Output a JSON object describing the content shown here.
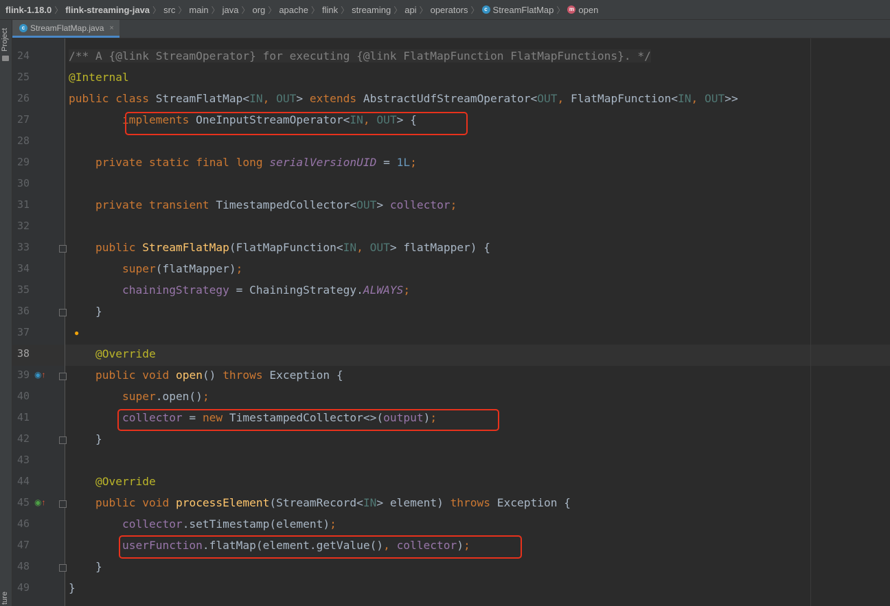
{
  "breadcrumb": {
    "items": [
      "flink-1.18.0",
      "flink-streaming-java",
      "src",
      "main",
      "java",
      "org",
      "apache",
      "flink",
      "streaming",
      "api",
      "operators",
      "StreamFlatMap",
      "open"
    ],
    "class_badge": "c",
    "method_badge": "m"
  },
  "sidebar": {
    "project_label": "Project",
    "structure_label": "ture"
  },
  "tabs": [
    {
      "label": "StreamFlatMap.java",
      "close": "×"
    }
  ],
  "editor": {
    "current_line": "38",
    "lines": [
      {
        "num": "24",
        "text": "/** A {@link StreamOperator} for executing {@link FlatMapFunction FlatMapFunctions}. */"
      },
      {
        "num": "25",
        "text": "@Internal"
      },
      {
        "num": "26",
        "text": "public class StreamFlatMap<IN, OUT> extends AbstractUdfStreamOperator<OUT, FlatMapFunction<IN, OUT>>"
      },
      {
        "num": "27",
        "text": "        implements OneInputStreamOperator<IN, OUT> {"
      },
      {
        "num": "28",
        "text": ""
      },
      {
        "num": "29",
        "text": "    private static final long serialVersionUID = 1L;"
      },
      {
        "num": "30",
        "text": ""
      },
      {
        "num": "31",
        "text": "    private transient TimestampedCollector<OUT> collector;"
      },
      {
        "num": "32",
        "text": ""
      },
      {
        "num": "33",
        "text": "    public StreamFlatMap(FlatMapFunction<IN, OUT> flatMapper) {"
      },
      {
        "num": "34",
        "text": "        super(flatMapper);"
      },
      {
        "num": "35",
        "text": "        chainingStrategy = ChainingStrategy.ALWAYS;"
      },
      {
        "num": "36",
        "text": "    }"
      },
      {
        "num": "37",
        "text": ""
      },
      {
        "num": "38",
        "text": "    @Override"
      },
      {
        "num": "39",
        "text": "    public void open() throws Exception {"
      },
      {
        "num": "40",
        "text": "        super.open();"
      },
      {
        "num": "41",
        "text": "        collector = new TimestampedCollector<>(output);"
      },
      {
        "num": "42",
        "text": "    }"
      },
      {
        "num": "43",
        "text": ""
      },
      {
        "num": "44",
        "text": "    @Override"
      },
      {
        "num": "45",
        "text": "    public void processElement(StreamRecord<IN> element) throws Exception {"
      },
      {
        "num": "46",
        "text": "        collector.setTimestamp(element);"
      },
      {
        "num": "47",
        "text": "        userFunction.flatMap(element.getValue(), collector);"
      },
      {
        "num": "48",
        "text": "    }"
      },
      {
        "num": "49",
        "text": "}"
      }
    ]
  },
  "highlight_color": "#e8321c",
  "icons": [
    "class-icon",
    "method-icon",
    "fold-marker-icon",
    "intention-bulb-icon",
    "override-icon"
  ]
}
